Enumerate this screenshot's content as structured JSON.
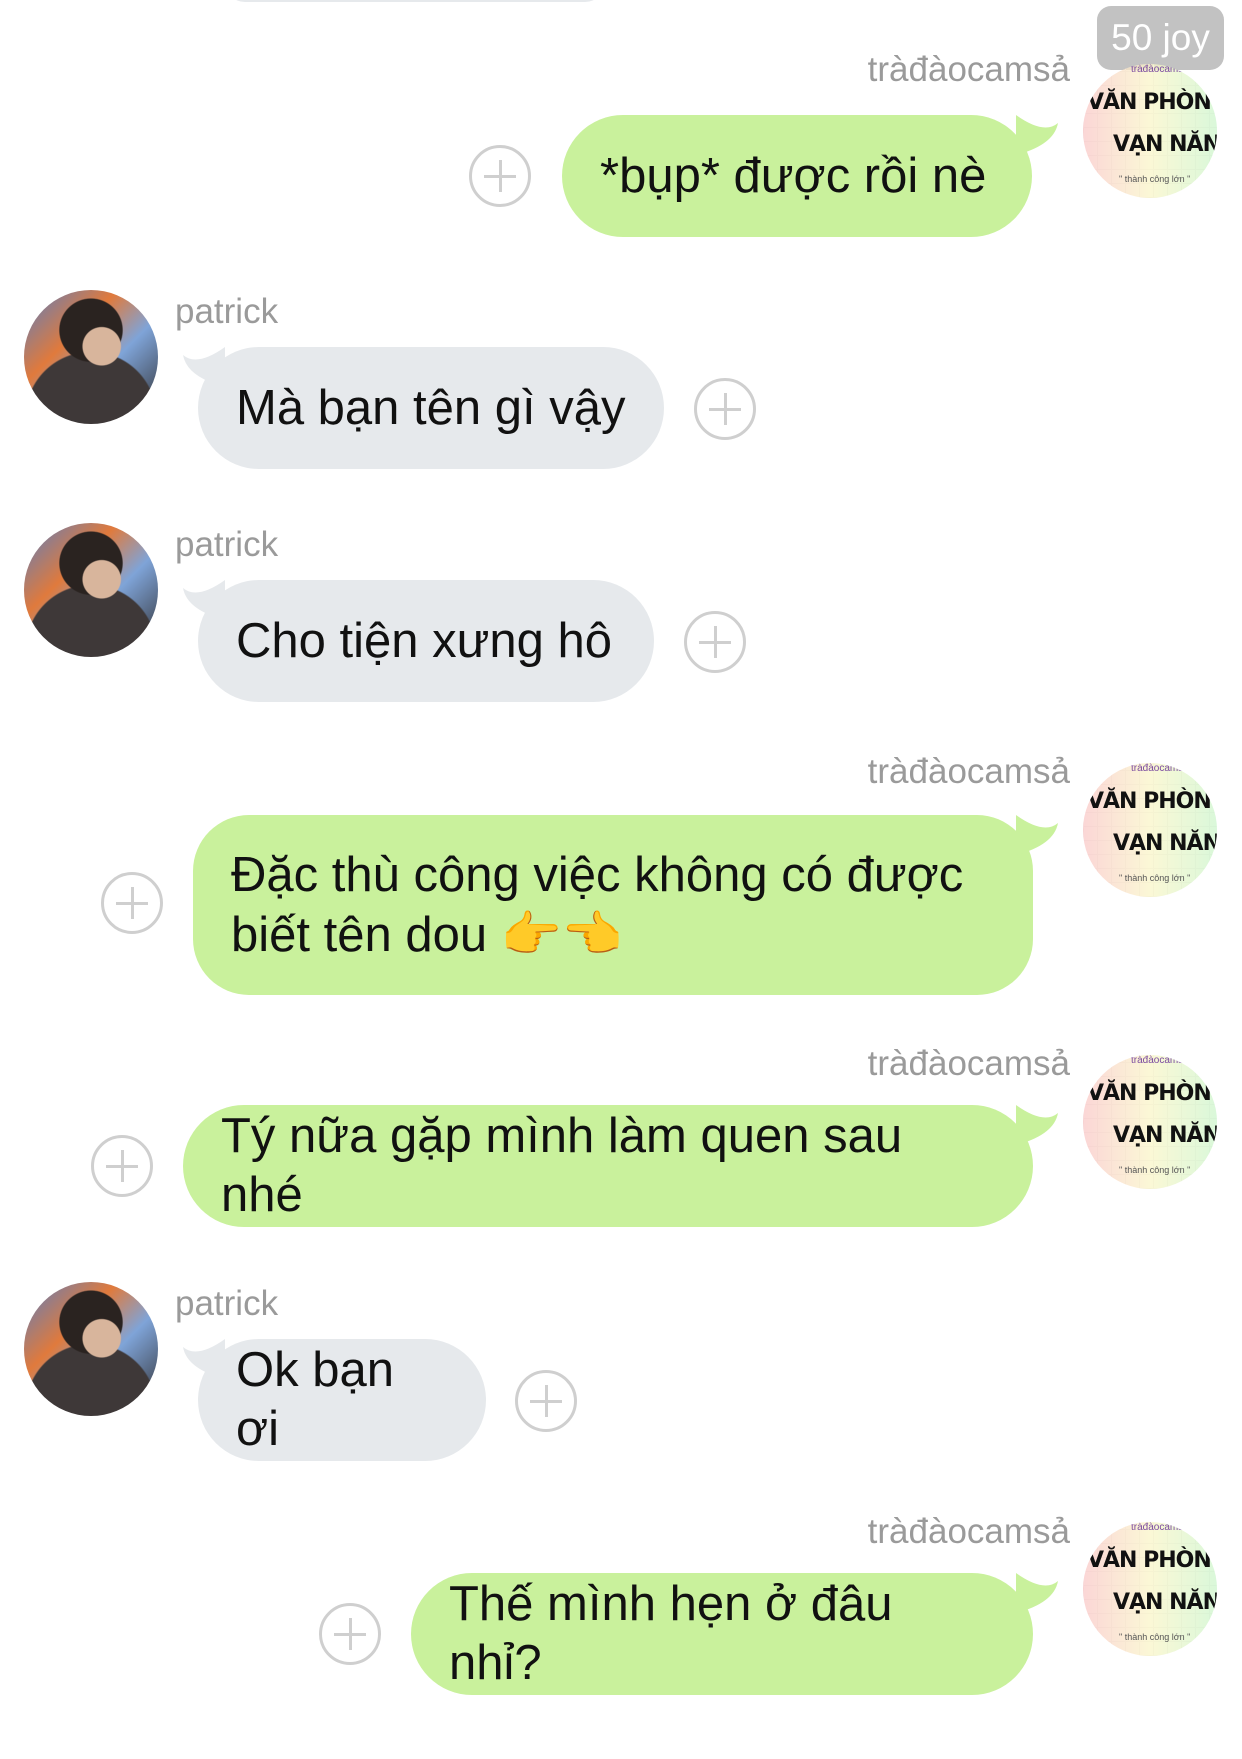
{
  "badge": {
    "label": "50 joy"
  },
  "me": {
    "name": "tràđàocamsả",
    "logo": {
      "line1": "VĂN PHÒNG",
      "line2": "VẠN NĂNG",
      "top": "tràđàocamsả",
      "sub": "\" thành công lớn \""
    }
  },
  "them": {
    "name": "patrick"
  },
  "messages": [
    {
      "from": "me",
      "text": "*bụp* được rồi nè"
    },
    {
      "from": "them",
      "text": "Mà bạn tên gì vậy"
    },
    {
      "from": "them",
      "text": "Cho tiện xưng hô"
    },
    {
      "from": "me",
      "text_line1": "Đặc thù công việc không có được",
      "text_line2": "biết tên dou",
      "emoji": "👉👈"
    },
    {
      "from": "me",
      "text": "Tý nữa gặp mình làm quen sau nhé"
    },
    {
      "from": "them",
      "text": "Ok bạn ơi"
    },
    {
      "from": "me",
      "text": "Thế mình hẹn ở đâu nhỉ?"
    }
  ],
  "colors": {
    "my_bubble": "#c9f19c",
    "their_bubble": "#e6e9ec",
    "name_text": "#9a9a9a",
    "plus_icon": "#cfcfcf"
  }
}
